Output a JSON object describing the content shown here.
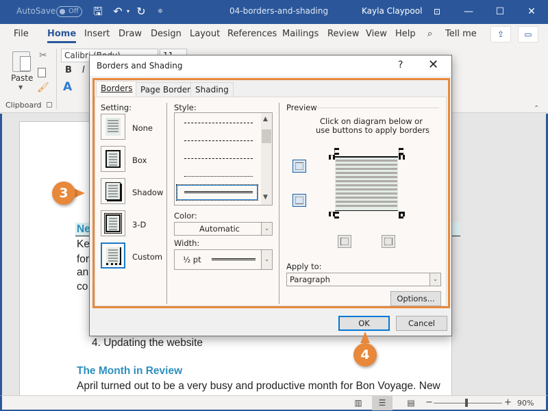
{
  "titlebar": {
    "autosave_label": "AutoSave",
    "autosave_state": "Off",
    "document_title": "04-borders-and-shading",
    "user_name": "Kayla Claypool",
    "icons": [
      "save-icon",
      "undo-icon",
      "redo-icon",
      "customize-qat-icon",
      "ribbon-display-icon",
      "minimize-icon",
      "maximize-icon",
      "close-icon"
    ]
  },
  "ribbon": {
    "tabs": [
      {
        "label": "File"
      },
      {
        "label": "Home",
        "active": true
      },
      {
        "label": "Insert"
      },
      {
        "label": "Draw"
      },
      {
        "label": "Design"
      },
      {
        "label": "Layout"
      },
      {
        "label": "References"
      },
      {
        "label": "Mailings"
      },
      {
        "label": "Review"
      },
      {
        "label": "View"
      },
      {
        "label": "Help"
      }
    ],
    "tell_me": "Tell me",
    "clipboard": {
      "paste_label": "Paste",
      "group_label": "Clipboard"
    },
    "font": {
      "name": "Calibri (Body)",
      "size": "11",
      "bold": "B",
      "italic": "I"
    }
  },
  "document": {
    "heading1_partial": "Ne",
    "lines_partial": [
      "Ke",
      "for",
      "an",
      "co"
    ],
    "list_item": "4.  Updating the website",
    "heading2": "The Month in Review",
    "paragraph": "April turned out to be a very busy and productive month for Bon Voyage. New"
  },
  "dialog": {
    "title": "Borders and Shading",
    "help": "?",
    "close": "✕",
    "tabs": [
      {
        "label": "Borders",
        "active": true
      },
      {
        "label": "Page Border"
      },
      {
        "label": "Shading"
      }
    ],
    "setting": {
      "label": "Setting:",
      "options": [
        {
          "label": "None"
        },
        {
          "label": "Box"
        },
        {
          "label": "Shadow"
        },
        {
          "label": "3-D"
        },
        {
          "label": "Custom",
          "selected": true
        }
      ]
    },
    "style": {
      "label": "Style:",
      "items": [
        "dashed-fine",
        "dashed",
        "dash-dot",
        "dash-dot-dot",
        "double"
      ],
      "selected": "double"
    },
    "color": {
      "label": "Color:",
      "value": "Automatic"
    },
    "width": {
      "label": "Width:",
      "value": "½ pt"
    },
    "preview": {
      "label": "Preview",
      "instructions_line1": "Click on diagram below or",
      "instructions_line2": "use buttons to apply borders",
      "buttons": [
        {
          "name": "top-border",
          "active": true
        },
        {
          "name": "bottom-border",
          "active": true
        },
        {
          "name": "left-border",
          "active": false
        },
        {
          "name": "right-border",
          "active": false
        }
      ]
    },
    "apply_to": {
      "label": "Apply to:",
      "value": "Paragraph"
    },
    "options_button": "Options...",
    "ok_button": "OK",
    "cancel_button": "Cancel"
  },
  "callouts": [
    {
      "number": "3"
    },
    {
      "number": "4"
    }
  ],
  "statusbar": {
    "zoom_percent": "90%",
    "zoom_value": 90,
    "view_modes": [
      "read-mode",
      "print-layout",
      "web-layout"
    ],
    "active_view": "print-layout"
  },
  "colors": {
    "word_blue": "#2b579a",
    "callout_orange": "#e8883a",
    "heading_blue": "#2e8fbf",
    "default_button_border": "#0078d7"
  }
}
